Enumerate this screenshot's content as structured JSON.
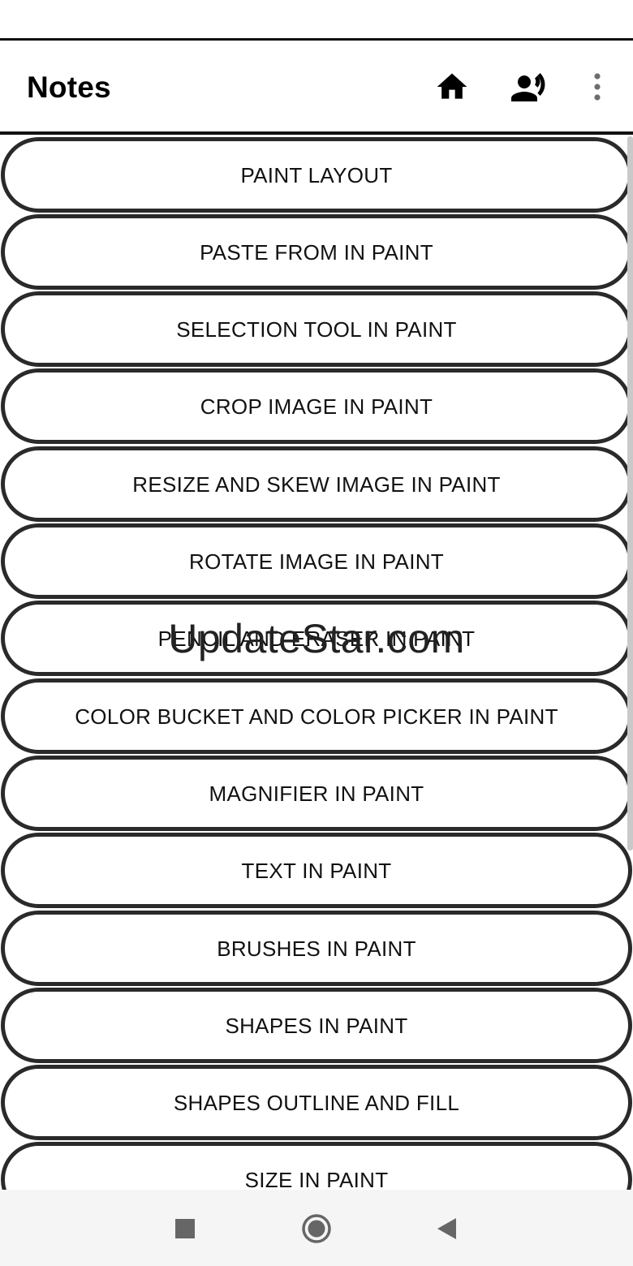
{
  "app_bar": {
    "title": "Notes",
    "actions": [
      {
        "icon": "home-icon"
      },
      {
        "icon": "voice-icon"
      },
      {
        "icon": "more-vertical-icon"
      }
    ]
  },
  "topics": [
    "PAINT LAYOUT",
    "PASTE FROM IN PAINT",
    "SELECTION TOOL IN PAINT",
    "CROP IMAGE IN PAINT",
    "RESIZE AND SKEW IMAGE IN PAINT",
    "ROTATE IMAGE IN PAINT",
    "PENCIL AND ERASER IN PAINT",
    "COLOR BUCKET AND COLOR PICKER IN PAINT",
    "MAGNIFIER IN PAINT",
    "TEXT IN PAINT",
    "BRUSHES IN PAINT",
    "SHAPES IN PAINT",
    "SHAPES OUTLINE AND FILL",
    "SIZE IN PAINT"
  ],
  "watermark": "UpdateStar.com",
  "nav_bar": {
    "buttons": [
      {
        "icon": "recents-square-icon"
      },
      {
        "icon": "home-circle-icon"
      },
      {
        "icon": "back-triangle-icon"
      }
    ]
  },
  "colors": {
    "outline": "#2a2a2a",
    "text": "#111111",
    "background": "#ffffff",
    "nav_background": "#f5f5f5"
  }
}
